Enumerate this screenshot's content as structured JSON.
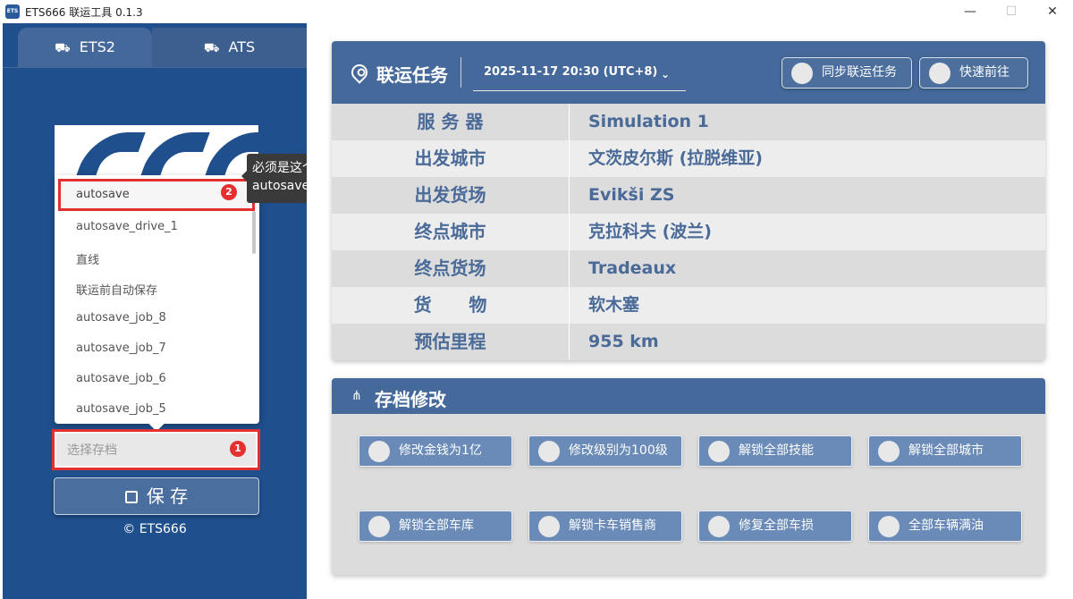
{
  "window": {
    "title": "ETS666 联运工具 0.1.3",
    "icon_name": "app-logo-icon",
    "controls": {
      "minimize": "—",
      "maximize": "☐",
      "close": "✕"
    }
  },
  "tabs": [
    {
      "label": "ETS2",
      "icon": "truck-icon",
      "active": true
    },
    {
      "label": "ATS",
      "icon": "truck-icon",
      "active": false
    }
  ],
  "dropdown": {
    "items": [
      "autosave",
      "autosave_drive_1",
      "直线",
      "联运前自动保存",
      "autosave_job_8",
      "autosave_job_7",
      "autosave_job_6",
      "autosave_job_5"
    ],
    "highlighted_badge": "2",
    "tooltip": "必须是这个autosave"
  },
  "save_select": {
    "placeholder": "选择存档",
    "badge": "1"
  },
  "save_button": {
    "label": "保    存",
    "icon": "save-icon"
  },
  "copyright": "© ETS666",
  "mission": {
    "title": "联运任务",
    "icon": "location-pin-icon",
    "datetime": "2025-11-17 20:30 (UTC+8)",
    "buttons": {
      "sync": "同步联运任务",
      "go": "快速前往"
    },
    "rows": [
      {
        "label": "服 务 器",
        "value": "Simulation 1"
      },
      {
        "label": "出发城市",
        "value": "文茨皮尔斯 (拉脱维亚)"
      },
      {
        "label": "出发货场",
        "value": "Evikši ZS"
      },
      {
        "label": "终点城市",
        "value": "克拉科夫 (波兰)"
      },
      {
        "label": "终点货场",
        "value": "Tradeaux"
      },
      {
        "label": "货      物",
        "value": "软木塞"
      },
      {
        "label": "预估里程",
        "value": "955 km"
      }
    ]
  },
  "save_mod": {
    "title": "存档修改",
    "icon": "share-icon",
    "buttons": [
      "修改金钱为1亿",
      "修改级别为100级",
      "解锁全部技能",
      "解锁全部城市",
      "解锁全部车库",
      "解锁卡车销售商",
      "修复全部车损",
      "全部车辆满油"
    ]
  },
  "colors": {
    "sidebar_bg": "#1f4f8c",
    "header_blue": "#44699a",
    "accent_red": "#e03030",
    "label_blue": "#4a6a98"
  }
}
